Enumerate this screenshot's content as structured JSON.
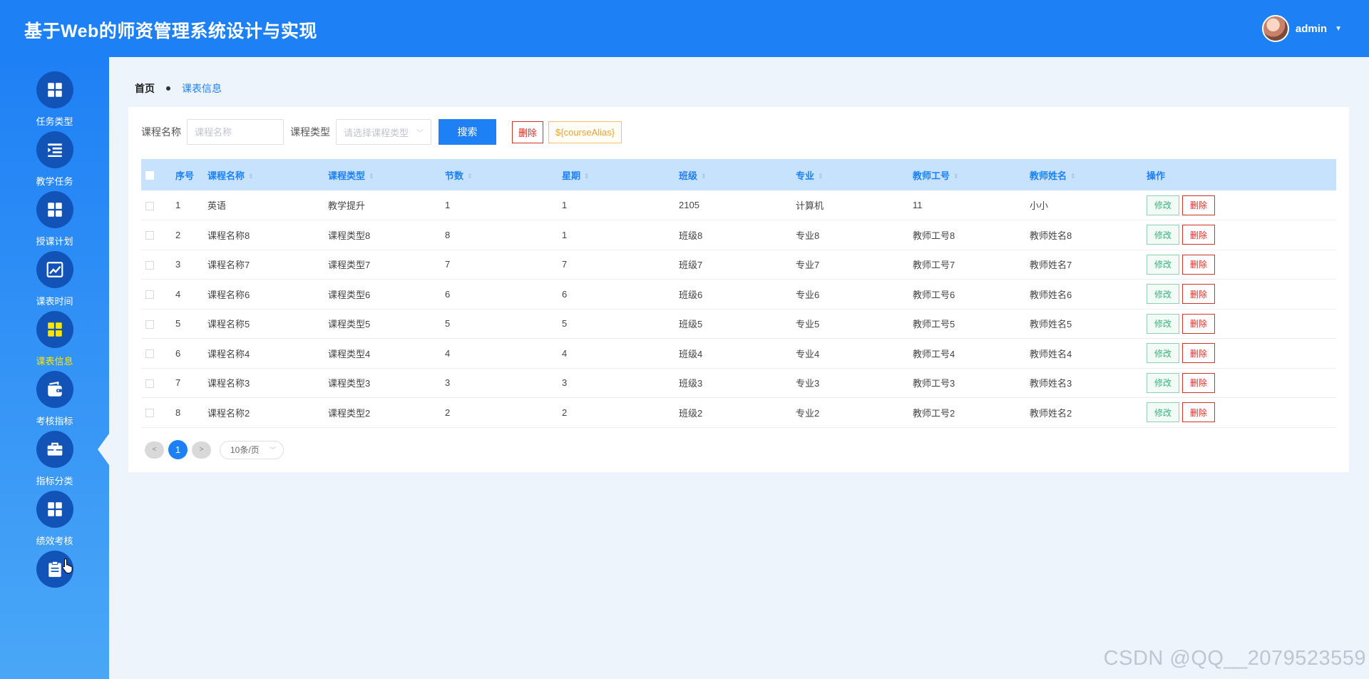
{
  "app": {
    "title": "基于Web的师资管理系统设计与实现",
    "user": {
      "name": "admin"
    }
  },
  "sidebar": {
    "active_index": 4,
    "items": [
      {
        "label": "任务类型",
        "icon": "grid-icon"
      },
      {
        "label": "教学任务",
        "icon": "list-indent-icon"
      },
      {
        "label": "授课计划",
        "icon": "grid-icon"
      },
      {
        "label": "课表时间",
        "icon": "chart-line-icon"
      },
      {
        "label": "课表信息",
        "icon": "grid-icon"
      },
      {
        "label": "考核指标",
        "icon": "wallet-icon"
      },
      {
        "label": "指标分类",
        "icon": "briefcase-icon"
      },
      {
        "label": "绩效考核",
        "icon": "grid-icon"
      },
      {
        "label": "",
        "icon": "clipboard-icon"
      }
    ]
  },
  "breadcrumb": {
    "home": "首页",
    "current": "课表信息"
  },
  "search": {
    "course_name_label": "课程名称",
    "course_name_placeholder": "课程名称",
    "course_type_label": "课程类型",
    "course_type_placeholder": "请选择课程类型",
    "search_button": "搜索",
    "delete_button": "删除",
    "alias_button": "${courseAlias}"
  },
  "table": {
    "headers": [
      "序号",
      "课程名称",
      "课程类型",
      "节数",
      "星期",
      "班级",
      "专业",
      "教师工号",
      "教师姓名",
      "操作"
    ],
    "rows": [
      [
        "1",
        "英语",
        "教学提升",
        "1",
        "1",
        "2105",
        "计算机",
        "11",
        "小小"
      ],
      [
        "2",
        "课程名称8",
        "课程类型8",
        "8",
        "1",
        "班级8",
        "专业8",
        "教师工号8",
        "教师姓名8"
      ],
      [
        "3",
        "课程名称7",
        "课程类型7",
        "7",
        "7",
        "班级7",
        "专业7",
        "教师工号7",
        "教师姓名7"
      ],
      [
        "4",
        "课程名称6",
        "课程类型6",
        "6",
        "6",
        "班级6",
        "专业6",
        "教师工号6",
        "教师姓名6"
      ],
      [
        "5",
        "课程名称5",
        "课程类型5",
        "5",
        "5",
        "班级5",
        "专业5",
        "教师工号5",
        "教师姓名5"
      ],
      [
        "6",
        "课程名称4",
        "课程类型4",
        "4",
        "4",
        "班级4",
        "专业4",
        "教师工号4",
        "教师姓名4"
      ],
      [
        "7",
        "课程名称3",
        "课程类型3",
        "3",
        "3",
        "班级3",
        "专业3",
        "教师工号3",
        "教师姓名3"
      ],
      [
        "8",
        "课程名称2",
        "课程类型2",
        "2",
        "2",
        "班级2",
        "专业2",
        "教师工号2",
        "教师姓名2"
      ]
    ],
    "edit_label": "修改",
    "delete_label": "删除"
  },
  "pagination": {
    "prev": "<",
    "current_page": "1",
    "next": ">",
    "page_size": "10条/页"
  },
  "watermark": "CSDN @QQ__2079523559",
  "colors": {
    "primary": "#1e80f5",
    "header_row": "#c6e2fc",
    "danger": "#d0342c",
    "success": "#3bb07c",
    "warning": "#e6a23c",
    "active_nav": "#ffe600"
  }
}
